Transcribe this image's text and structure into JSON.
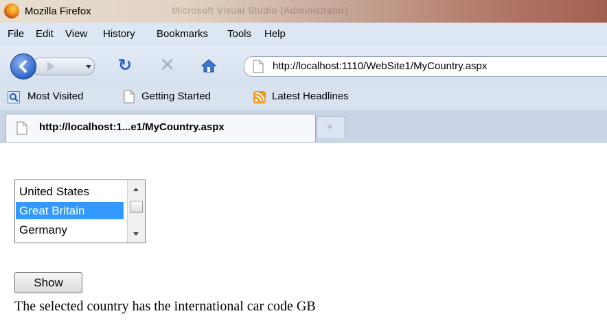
{
  "window": {
    "title": "Mozilla Firefox",
    "background_title": "Microsoft Visual Studio (Administrator)"
  },
  "menu": {
    "items": [
      "File",
      "Edit",
      "View",
      "History",
      "Bookmarks",
      "Tools",
      "Help"
    ]
  },
  "nav": {
    "url": "http://localhost:1110/WebSite1/MyCountry.aspx"
  },
  "bookmarks": {
    "items": [
      "Most Visited",
      "Getting Started",
      "Latest Headlines"
    ]
  },
  "tabs": {
    "active": "http://localhost:1...e1/MyCountry.aspx",
    "new_tab": "+"
  },
  "page": {
    "country_list": {
      "options": [
        "United States",
        "Great Britain",
        "Germany"
      ],
      "selected": "Great Britain"
    },
    "show_button": "Show",
    "result_text": "The selected country has the international car code GB"
  },
  "colors": {
    "selection": "#3399ff",
    "link_blue": "#2a63c6",
    "titlebar_accent": "#a06050"
  },
  "icons": [
    "firefox-logo-icon",
    "back-arrow-icon",
    "forward-arrow-icon",
    "reload-icon",
    "stop-icon",
    "home-icon",
    "page-icon",
    "search-bookmark-icon",
    "rss-feed-icon"
  ]
}
